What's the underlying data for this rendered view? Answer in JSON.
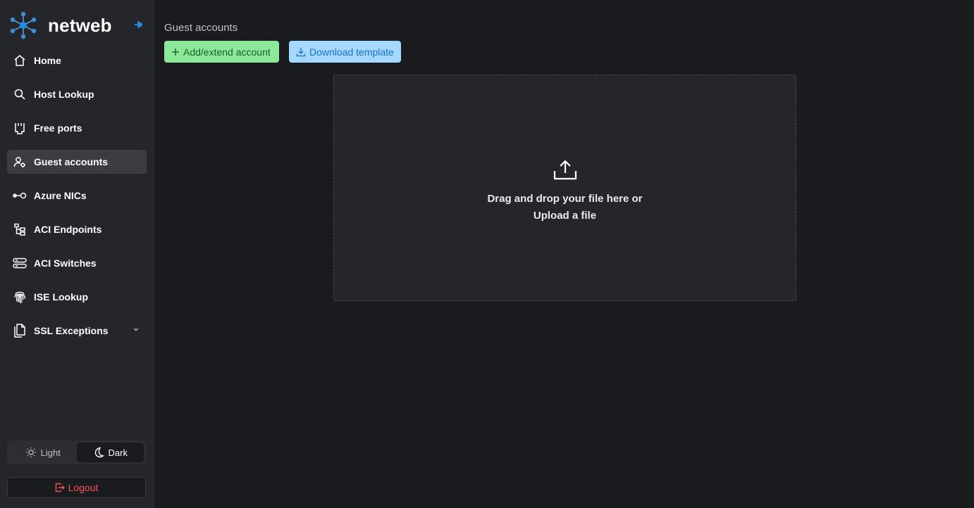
{
  "brand": {
    "name": "netweb",
    "accent": "#228be6"
  },
  "sidebar": {
    "items": [
      {
        "label": "Home",
        "icon": "home-icon"
      },
      {
        "label": "Host Lookup",
        "icon": "search-icon"
      },
      {
        "label": "Free ports",
        "icon": "ethernet-port-icon"
      },
      {
        "label": "Guest accounts",
        "icon": "user-cog-icon",
        "active": true
      },
      {
        "label": "Azure NICs",
        "icon": "plug-connection-icon"
      },
      {
        "label": "ACI Endpoints",
        "icon": "hierarchy-icon"
      },
      {
        "label": "ACI Switches",
        "icon": "server-icon"
      },
      {
        "label": "ISE Lookup",
        "icon": "fingerprint-icon"
      },
      {
        "label": "SSL Exceptions",
        "icon": "files-icon",
        "has_submenu": true
      }
    ]
  },
  "theme": {
    "light_label": "Light",
    "dark_label": "Dark",
    "selected": "Dark"
  },
  "logout_label": "Logout",
  "main": {
    "title": "Guest accounts",
    "add_button": "Add/extend account",
    "download_button": "Download template",
    "dropzone": {
      "line1": "Drag and drop your file here or",
      "line2": "Upload a file"
    }
  },
  "colors": {
    "add_bg": "#8ce99a",
    "download_bg": "#a5d8ff",
    "logout": "#fa5252"
  }
}
